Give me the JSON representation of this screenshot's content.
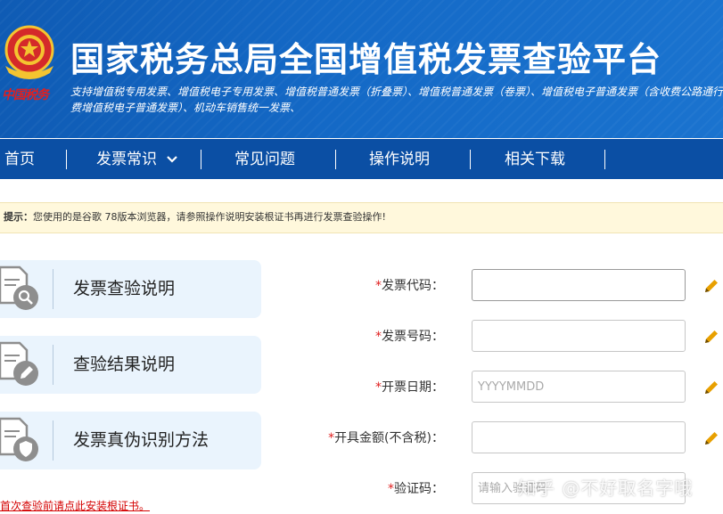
{
  "header": {
    "title": "国家税务总局全国增值税发票查验平台",
    "subtitle": "支持增值税专用发票、增值税电子专用发票、增值税普通发票（折叠票）、增值税普通发票（卷票）、增值税电子普通发票（含收费公路通行费增值税电子普通发票）、机动车销售统一发票、",
    "emblem_text": "中国税务",
    "emblem_icon": "tax-emblem-icon"
  },
  "nav": {
    "items": [
      {
        "label": "首页"
      },
      {
        "label": "发票常识",
        "has_dropdown": true
      },
      {
        "label": "常见问题"
      },
      {
        "label": "操作说明"
      },
      {
        "label": "相关下载"
      }
    ]
  },
  "notice": {
    "label": "提示：",
    "text": "您使用的是谷歌 78版本浏览器，请参照操作说明安装根证书再进行发票查验操作!"
  },
  "cards": [
    {
      "label": "发票查验说明",
      "icon": "document-search-icon"
    },
    {
      "label": "查验结果说明",
      "icon": "document-edit-icon"
    },
    {
      "label": "发票真伪识别方法",
      "icon": "document-shield-icon"
    }
  ],
  "bottom_link": "首次查验前请点此安装根证书。",
  "form": {
    "fields": [
      {
        "label": "发票代码：",
        "value": "",
        "placeholder": ""
      },
      {
        "label": "发票号码：",
        "value": "",
        "placeholder": ""
      },
      {
        "label": "开票日期：",
        "value": "",
        "placeholder": "YYYYMMDD"
      },
      {
        "label": "开具金额(不含税)：",
        "value": "",
        "placeholder": ""
      },
      {
        "label": "验证码：",
        "value": "",
        "placeholder": "请输入验证码"
      }
    ],
    "required_mark": "*"
  },
  "watermark": "知乎 @不好取名字哦",
  "colors": {
    "header_blue": "#1469c6",
    "nav_blue": "#0b4fa4",
    "notice_bg": "#fff8dc",
    "card_bg": "#eaf4fd",
    "required_red": "#e02020",
    "pencil_orange": "#e8a000"
  }
}
